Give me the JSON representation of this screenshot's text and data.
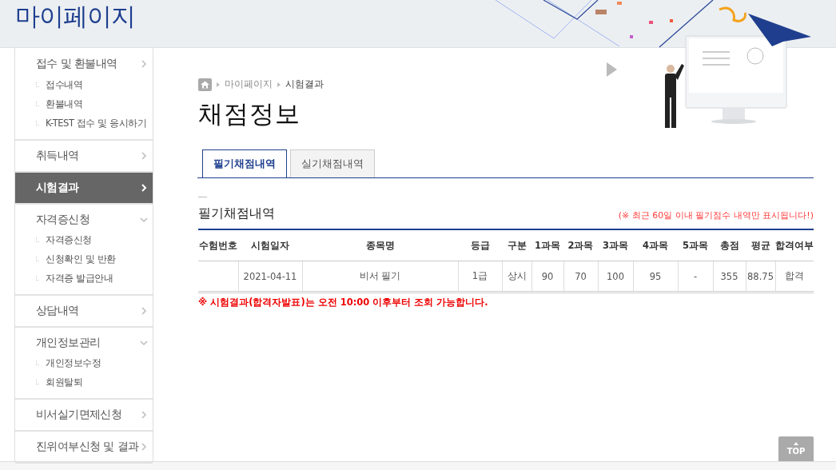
{
  "header": {
    "title": "마이페이지"
  },
  "sidebar": {
    "groups": [
      {
        "label": "접수 및 환불내역",
        "expanded": false,
        "selected": false,
        "children": [
          {
            "label": "접수내역"
          },
          {
            "label": "환불내역"
          },
          {
            "label": "K-TEST 접수 및 응시하기"
          }
        ]
      },
      {
        "label": "취득내역",
        "expanded": false,
        "selected": false
      },
      {
        "label": "시험결과",
        "expanded": false,
        "selected": true
      },
      {
        "label": "자격증신청",
        "expanded": true,
        "selected": false,
        "children": [
          {
            "label": "자격증신청"
          },
          {
            "label": "신청확인 및 반환"
          },
          {
            "label": "자격증 발급안내"
          }
        ]
      },
      {
        "label": "상담내역",
        "expanded": false,
        "selected": false
      },
      {
        "label": "개인정보관리",
        "expanded": true,
        "selected": false,
        "children": [
          {
            "label": "개인정보수정"
          },
          {
            "label": "회원탈퇴"
          }
        ]
      },
      {
        "label": "비서실기면제신청",
        "expanded": false,
        "selected": false
      },
      {
        "label": "진위여부신청 및 결과",
        "expanded": false,
        "selected": false
      }
    ]
  },
  "breadcrumb": [
    "마이페이지",
    "시험결과"
  ],
  "page_title": "채점정보",
  "tabs": [
    {
      "label": "필기채점내역",
      "selected": true
    },
    {
      "label": "실기채점내역",
      "selected": false
    }
  ],
  "section": {
    "title": "필기채점내역",
    "note": "(※ 최근 60일 이내 필기점수 내역만 표시됩니다!)"
  },
  "table": {
    "columns": [
      "수험번호",
      "시험일자",
      "종목명",
      "등급",
      "구분",
      "1과목",
      "2과목",
      "3과목",
      "4과목",
      "5과목",
      "총점",
      "평균",
      "합격여부"
    ],
    "rows": [
      [
        "",
        "2021-04-11",
        "비서 필기",
        "1급",
        "상시",
        "90",
        "70",
        "100",
        "95",
        "-",
        "355",
        "88.75",
        "합격"
      ]
    ]
  },
  "notice": "※ 시험결과(합격자발표)는 오전 10:00 이후부터 조회 가능합니다.",
  "top_button": "TOP"
}
